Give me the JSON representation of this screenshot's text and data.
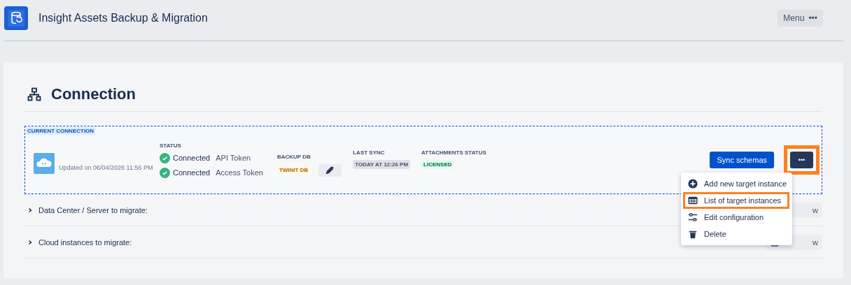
{
  "header": {
    "title": "Insight Assets Backup & Migration",
    "menu_button": {
      "label": "Menu",
      "icon": "•••"
    }
  },
  "section": {
    "title": "Connection"
  },
  "current_connection": {
    "tag": "CURRENT CONNECTION",
    "updated": "Updated on 06/04/2026 11:56 PM",
    "status": {
      "heading": "STATUS",
      "items": [
        {
          "state": "Connected",
          "token": "API Token"
        },
        {
          "state": "Connected",
          "token": "Access Token"
        }
      ]
    },
    "backup_db": {
      "heading": "BACKUP DB",
      "value": "TWINIT DB"
    },
    "last_sync": {
      "heading": "LAST SYNC",
      "value": "TODAY AT 12:26 PM"
    },
    "attachments": {
      "heading": "ATTACHMENTS STATUS",
      "value": "LICENSED"
    },
    "sync_button": "Sync schemas",
    "more_button": {
      "label": "•••",
      "highlighted": true
    }
  },
  "dropdown": [
    {
      "kind": "add",
      "label": "Add new target instance",
      "highlighted": false
    },
    {
      "kind": "list",
      "label": "List of target instances",
      "highlighted": true
    },
    {
      "kind": "config",
      "label": "Edit configuration",
      "highlighted": false
    },
    {
      "kind": "delete",
      "label": "Delete",
      "highlighted": false
    }
  ],
  "rows": [
    {
      "label": "Data Center / Server to migrate:",
      "expanded": false,
      "button": "w"
    },
    {
      "label": "Cloud instances to migrate:",
      "expanded": false,
      "button": "w",
      "icon": true
    }
  ]
}
